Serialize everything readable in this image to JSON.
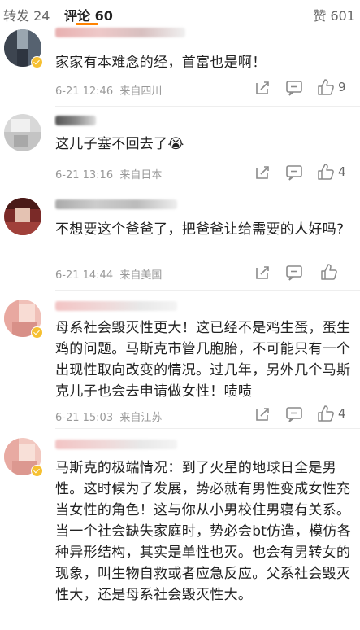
{
  "tabs": {
    "repost": "转发 24",
    "comment": "评论 60",
    "like": "赞 601"
  },
  "accent_color": "#ff8200",
  "comments": [
    {
      "text": "家家有本难念的经，首富也是啊！",
      "meta": "6-21 12:46  来自四川",
      "likes": "9",
      "verified": true
    },
    {
      "text": "这儿子塞不回去了😭",
      "meta": "6-21 13:16  来自日本",
      "likes": "4",
      "verified": false
    },
    {
      "text": "不想要这个爸爸了，把爸爸让给需要的人好吗?",
      "meta": "6-21 14:44  来自美国",
      "likes": "",
      "verified": false
    },
    {
      "text": "母系社会毁灭性更大！这已经不是鸡生蛋，蛋生鸡的问题。马斯克市管几胞胎，不可能只有一个出现性取向改变的情况。过几年，另外几个马斯克儿子也会去申请做女性！啧啧",
      "meta": "6-21 15:03  来自江苏",
      "likes": "4",
      "verified": true
    },
    {
      "text": "马斯克的极端情况：到了火星的地球日全是男性。这时候为了发展，势必就有男性变成女性充当女性的角色！这与你从小男校住男寝有关系。当一个社会缺失家庭时，势必会bt仿造，模仿各种异形结构，其实是单性也灭。也会有男转女的现象，叫生物自救或者应急反应。父系社会毁灭性大，还是母系社会毁灭性大。",
      "meta": "",
      "likes": "",
      "verified": true
    }
  ],
  "icons": [
    "share-icon",
    "comment-icon",
    "thumbs-up-icon",
    "verified-badge"
  ]
}
